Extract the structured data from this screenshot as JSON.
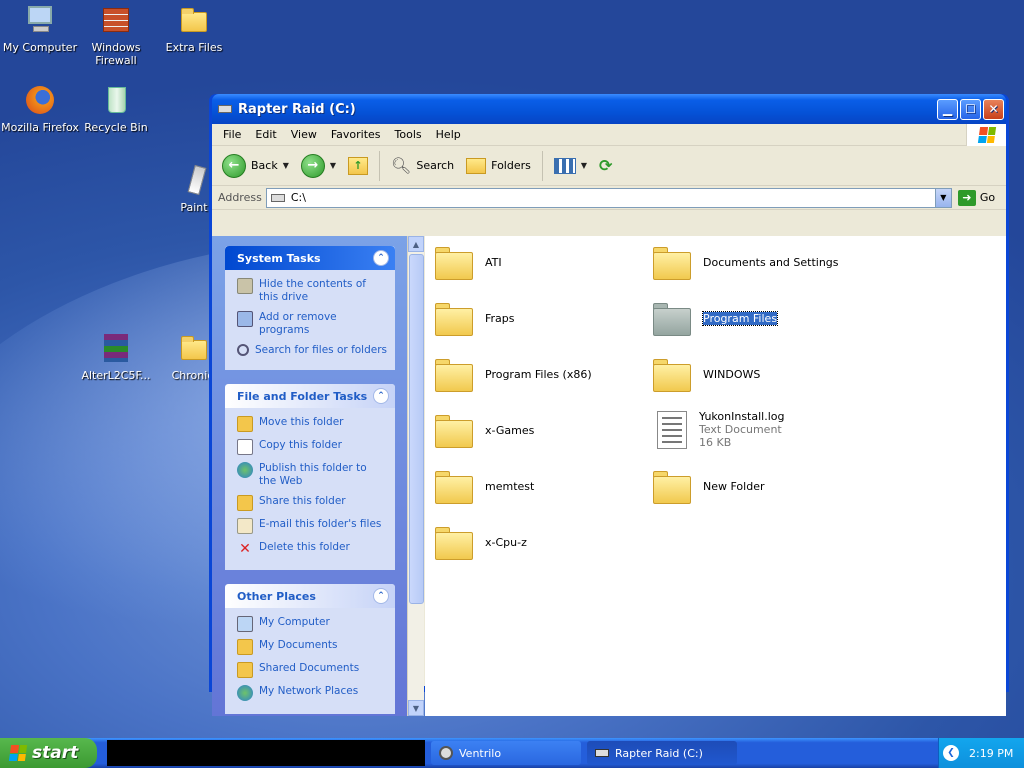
{
  "desktop": {
    "icons": [
      {
        "label": "My Computer"
      },
      {
        "label": "Windows Firewall"
      },
      {
        "label": "Extra Files"
      },
      {
        "label": "Mozilla Firefox"
      },
      {
        "label": "Recycle Bin"
      },
      {
        "label": "Paint"
      },
      {
        "label": "AlterL2C5F..."
      },
      {
        "label": "Chronicl"
      }
    ]
  },
  "window": {
    "title": "Rapter Raid (C:)",
    "menu": [
      "File",
      "Edit",
      "View",
      "Favorites",
      "Tools",
      "Help"
    ],
    "toolbar": {
      "back": "Back",
      "search": "Search",
      "folders": "Folders"
    },
    "address": {
      "label": "Address",
      "value": "C:\\",
      "go": "Go"
    }
  },
  "sidebar": {
    "system_tasks": {
      "title": "System Tasks",
      "items": [
        "Hide the contents of this drive",
        "Add or remove programs",
        "Search for files or folders"
      ]
    },
    "file_folder_tasks": {
      "title": "File and Folder Tasks",
      "items": [
        "Move this folder",
        "Copy this folder",
        "Publish this folder to the Web",
        "Share this folder",
        "E-mail this folder's files",
        "Delete this folder"
      ]
    },
    "other_places": {
      "title": "Other Places",
      "items": [
        "My Computer",
        "My Documents",
        "Shared Documents",
        "My Network Places"
      ]
    }
  },
  "files": [
    {
      "name": "ATI"
    },
    {
      "name": "Documents and Settings"
    },
    {
      "name": "Fraps"
    },
    {
      "name": "Program Files",
      "selected": true
    },
    {
      "name": "Program Files (x86)"
    },
    {
      "name": "WINDOWS"
    },
    {
      "name": "x-Games"
    },
    {
      "name": "YukonInstall.log",
      "type": "Text Document",
      "size": "16 KB"
    },
    {
      "name": "memtest"
    },
    {
      "name": "New Folder"
    },
    {
      "name": "x-Cpu-z"
    }
  ],
  "taskbar": {
    "start": "start",
    "tasks": [
      {
        "label": "Ventrilo"
      },
      {
        "label": "Rapter Raid (C:)"
      }
    ],
    "clock": "2:19 PM"
  },
  "colors": {
    "link": "#215dc6",
    "titlebar": "#0553d8",
    "selection": "#316ac5"
  }
}
